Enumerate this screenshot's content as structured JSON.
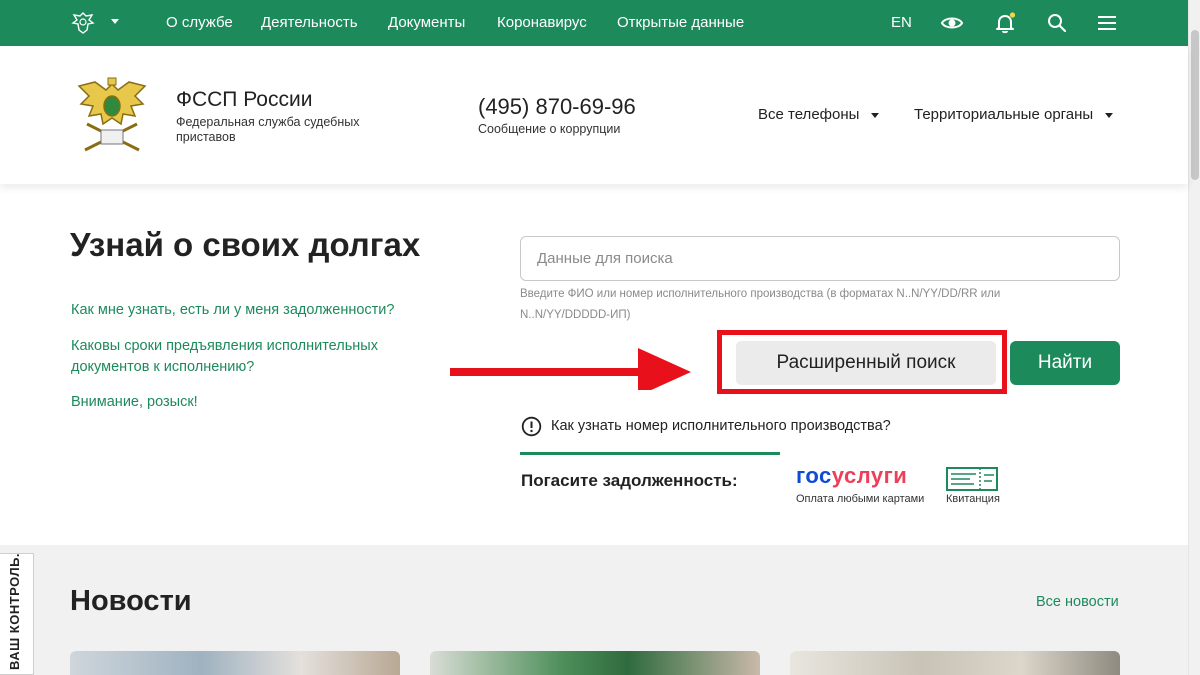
{
  "topnav": {
    "items": [
      "О службе",
      "Деятельность",
      "Документы",
      "Коронавирус",
      "Открытые данные"
    ],
    "lang": "EN",
    "icons": [
      "eye-icon",
      "bell-icon",
      "search-icon",
      "menu-icon"
    ],
    "notification_dot_color": "#f5d547"
  },
  "header": {
    "org_name": "ФССП России",
    "org_subtitle": "Федеральная служба судебных приставов",
    "phone": "(495) 870-69-96",
    "phone_caption": "Сообщение о коррупции",
    "dropdown_phones": "Все телефоны",
    "dropdown_territorial": "Территориальные органы"
  },
  "main": {
    "title": "Узнай о своих долгах",
    "faq": [
      "Как мне узнать, есть ли у меня задолженности?",
      "Каковы сроки предъявления исполнительных документов к исполнению?",
      "Внимание, розыск!"
    ],
    "search_placeholder": "Данные для поиска",
    "search_hint": "Введите ФИО или номер исполнительного производства (в форматах N..N/YY/DD/RR или N..N/YY/DDDDD-ИП)",
    "advanced_search_label": "Расширенный поиск",
    "find_label": "Найти",
    "info_question": "Как узнать номер исполнительного производства?",
    "pay_label": "Погасите задолженность:",
    "gosuslugi_part1": "гос",
    "gosuslugi_part2": "услуги",
    "gosuslugi_caption": "Оплата любыми картами",
    "receipt_caption": "Квитанция"
  },
  "news": {
    "title": "Новости",
    "all_news": "Все новости"
  },
  "side_tab": "ВАШ КОНТРОЛЬ.",
  "colors": {
    "brand_green": "#1d8a5c",
    "highlight_red": "#e8101a",
    "gos_blue": "#0d4cd3",
    "gos_red": "#ee3f58"
  }
}
